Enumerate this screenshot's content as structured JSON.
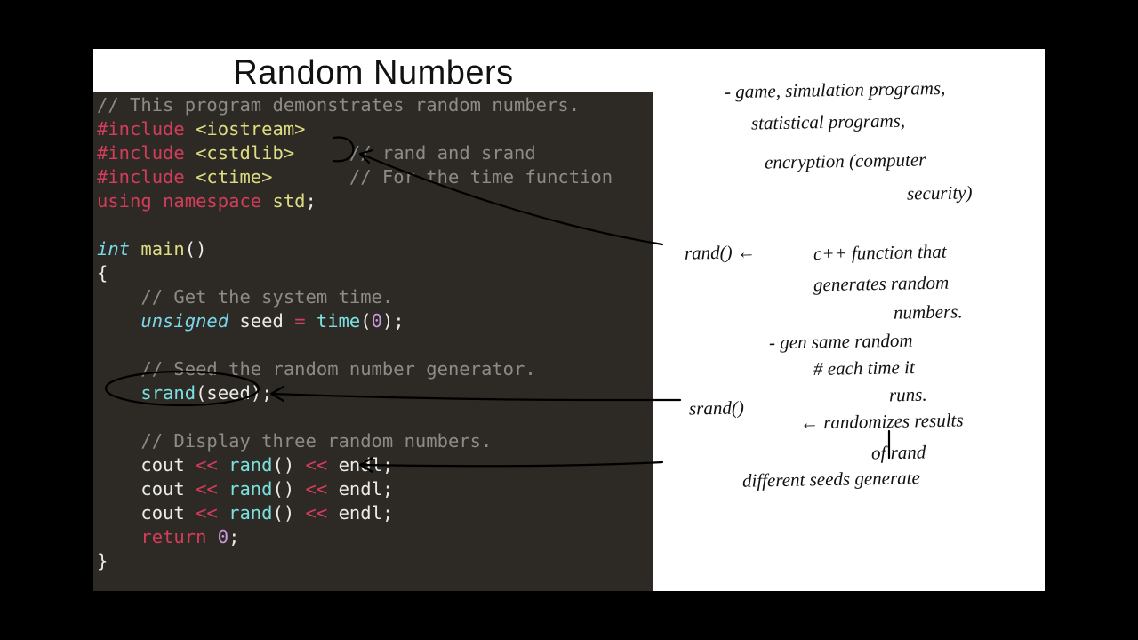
{
  "title": "Random Numbers",
  "code": {
    "l1_a": "// This program demonstrates random numbers.",
    "l2_kw": "#include",
    "l2_hdr": "<iostream>",
    "l3_kw": "#include",
    "l3_hdr": "<cstdlib>",
    "l3_cm": "// rand and srand",
    "l4_kw": "#include",
    "l4_hdr": "<ctime>",
    "l4_cm": "// For the time function",
    "l5_a": "using",
    "l5_b": "namespace",
    "l5_c": "std",
    "l5_d": ";",
    "l7_a": "int",
    "l7_b": "main",
    "l7_c": "()",
    "l8": "{",
    "l9_cm": "// Get the system time.",
    "l10_a": "unsigned",
    "l10_b": "seed",
    "l10_c": "=",
    "l10_d": "time",
    "l10_e": "(",
    "l10_f": "0",
    "l10_g": ");",
    "l12_cm": "// Seed the random number generator.",
    "l13_a": "srand",
    "l13_b": "(seed);",
    "l15_cm": "// Display three random numbers.",
    "l16_a": "cout",
    "l16_b": "<<",
    "l16_c": "rand",
    "l16_d": "()",
    "l16_e": "<<",
    "l16_f": "endl",
    "l16_g": ";",
    "l17_a": "cout",
    "l17_b": "<<",
    "l17_c": "rand",
    "l17_d": "()",
    "l17_e": "<<",
    "l17_f": "endl",
    "l17_g": ";",
    "l18_a": "cout",
    "l18_b": "<<",
    "l18_c": "rand",
    "l18_d": "()",
    "l18_e": "<<",
    "l18_f": "endl",
    "l18_g": ";",
    "l19_a": "return",
    "l19_b": "0",
    "l19_c": ";",
    "l20": "}"
  },
  "notes": {
    "n1": "- game, simulation programs,",
    "n2": "statistical programs,",
    "n3": "encryption (computer",
    "n4": "security)",
    "n5a": "rand() ←",
    "n5b": "c++ function that",
    "n6": "generates random",
    "n7": "numbers.",
    "n8": "- gen same random",
    "n9": "# each time it",
    "n10": "runs.",
    "n11a": "srand()",
    "n11b": "← randomizes results",
    "n12": "of rand",
    "n13": "different seeds generate"
  }
}
